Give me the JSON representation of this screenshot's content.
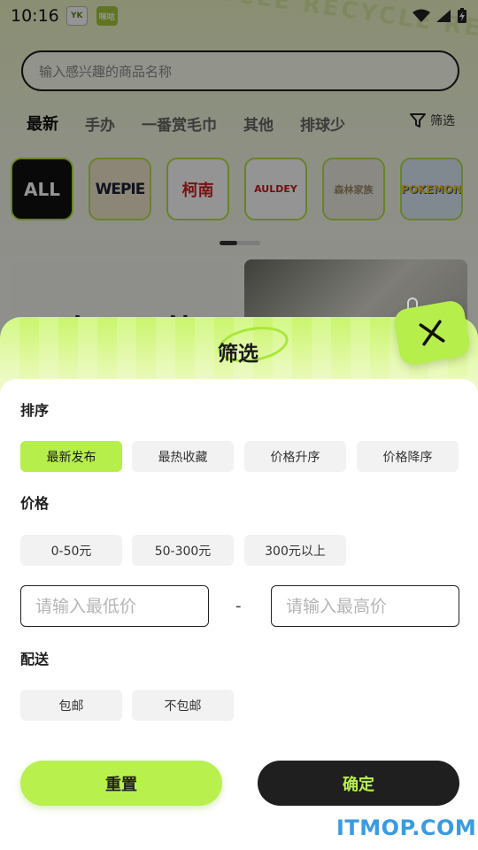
{
  "status_bar": {
    "time": "10:16",
    "app_icon_1": "YK",
    "app_icon_2": "咪咕"
  },
  "background": {
    "search_placeholder": "输入感兴趣的商品名称",
    "deco_text": "RECYCLE  RECYCLE  RECYCLE",
    "categories": [
      {
        "label": "最新",
        "active": true
      },
      {
        "label": "手办",
        "active": false
      },
      {
        "label": "一番赏毛巾",
        "active": false
      },
      {
        "label": "其他",
        "active": false
      },
      {
        "label": "排球少",
        "active": false
      }
    ],
    "filter_label": "筛选",
    "brands": [
      "ALL",
      "WEPIE",
      "柯南",
      "AULDEY",
      "森林家族",
      "POKEMON"
    ],
    "banner_text": "二次一 能"
  },
  "sheet": {
    "title": "筛选",
    "close_icon": "close-icon",
    "sort": {
      "title": "排序",
      "options": [
        {
          "label": "最新发布",
          "selected": true
        },
        {
          "label": "最热收藏",
          "selected": false
        },
        {
          "label": "价格升序",
          "selected": false
        },
        {
          "label": "价格降序",
          "selected": false
        }
      ]
    },
    "price": {
      "title": "价格",
      "options": [
        {
          "label": "0-50元",
          "selected": false
        },
        {
          "label": "50-300元",
          "selected": false
        },
        {
          "label": "300元以上",
          "selected": false
        }
      ],
      "min_placeholder": "请输入最低价",
      "max_placeholder": "请输入最高价",
      "separator": "-"
    },
    "delivery": {
      "title": "配送",
      "options": [
        {
          "label": "包邮",
          "selected": false
        },
        {
          "label": "不包邮",
          "selected": false
        }
      ]
    },
    "reset_label": "重置",
    "confirm_label": "确定"
  },
  "colors": {
    "accent": "#b6ee4c",
    "dark": "#1f1f1f"
  },
  "watermark": "ITMOP.COM"
}
